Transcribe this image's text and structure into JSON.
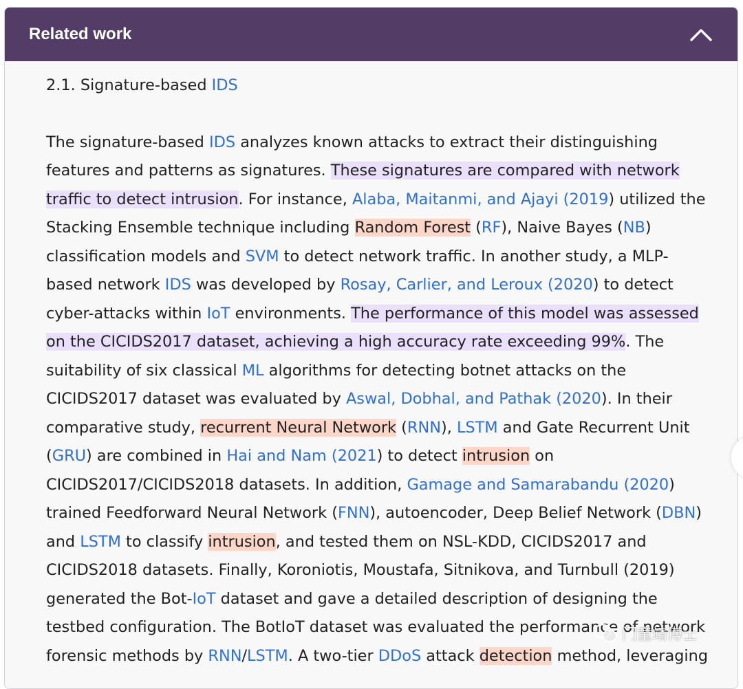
{
  "panel": {
    "title": "Related work",
    "collapse_icon": "chevron-up-icon",
    "accent_color": "#533d66"
  },
  "section": {
    "subheading_prefix": "2.1. Signature-based ",
    "subheading_link": "IDS"
  },
  "paragraph": [
    {
      "t": "The signature-based "
    },
    {
      "t": "IDS",
      "link": true
    },
    {
      "t": " analyzes known attacks to extract their distinguishing features and patterns as signatures. "
    },
    {
      "t": "These signatures are compared with network traffic to detect intrusion",
      "hl": "purple"
    },
    {
      "t": ". For instance, "
    },
    {
      "t": "Alaba, Maitanmi, and Ajayi (2019",
      "link": true
    },
    {
      "t": ") utilized the Stacking Ensemble technique including "
    },
    {
      "t": "Random Forest",
      "hl": "orange"
    },
    {
      "t": " ("
    },
    {
      "t": "RF",
      "link": true
    },
    {
      "t": "), Naive Bayes ("
    },
    {
      "t": "NB",
      "link": true
    },
    {
      "t": ") classification models and "
    },
    {
      "t": "SVM",
      "link": true
    },
    {
      "t": " to detect network traffic. In another study, a MLP-based network "
    },
    {
      "t": "IDS",
      "link": true
    },
    {
      "t": " was developed by "
    },
    {
      "t": "Rosay, Carlier, and Leroux (2020",
      "link": true
    },
    {
      "t": ") to detect cyber-attacks within "
    },
    {
      "t": "IoT",
      "link": true
    },
    {
      "t": " environments. "
    },
    {
      "t": "The performance of this model was assessed on the CICIDS2017 dataset, achieving a high accuracy rate exceeding 99%",
      "hl": "purple"
    },
    {
      "t": ". The suitability of six classical "
    },
    {
      "t": "ML",
      "link": true
    },
    {
      "t": " algorithms for detecting botnet attacks on the CICIDS2017 dataset was evaluated by "
    },
    {
      "t": "Aswal, Dobhal, and Pathak (2020",
      "link": true
    },
    {
      "t": "). In their comparative study, "
    },
    {
      "t": "recurrent Neural Network",
      "hl": "orange"
    },
    {
      "t": " ("
    },
    {
      "t": "RNN",
      "link": true
    },
    {
      "t": "), "
    },
    {
      "t": "LSTM",
      "link": true
    },
    {
      "t": " and Gate Recurrent Unit ("
    },
    {
      "t": "GRU",
      "link": true
    },
    {
      "t": ") are combined in "
    },
    {
      "t": "Hai and Nam (2021",
      "link": true
    },
    {
      "t": ") to detect "
    },
    {
      "t": "intrusion",
      "hl": "orange"
    },
    {
      "t": " on CICIDS2017/CICIDS2018 datasets. In addition, "
    },
    {
      "t": "Gamage and Samarabandu (2020",
      "link": true
    },
    {
      "t": ") trained Feedforward Neural Network ("
    },
    {
      "t": "FNN",
      "link": true
    },
    {
      "t": "), autoencoder, Deep Belief Network ("
    },
    {
      "t": "DBN",
      "link": true
    },
    {
      "t": ") and "
    },
    {
      "t": "LSTM",
      "link": true
    },
    {
      "t": " to classify "
    },
    {
      "t": "intrusion",
      "hl": "orange"
    },
    {
      "t": ", and tested them on NSL-KDD, CICIDS2017 and CICIDS2018 datasets. Finally, Koroniotis, Moustafa, Sitnikova, and Turnbull (2019) generated the Bot-"
    },
    {
      "t": "IoT",
      "link": true
    },
    {
      "t": " dataset and gave a detailed description of designing the testbed configuration. The BotIoT dataset was evaluated the performance of network forensic methods by "
    },
    {
      "t": "RNN",
      "link": true
    },
    {
      "t": "/"
    },
    {
      "t": "LSTM",
      "link": true
    },
    {
      "t": ". A two-tier "
    },
    {
      "t": "DDoS",
      "link": true
    },
    {
      "t": " attack "
    },
    {
      "t": "detection",
      "hl": "orange"
    },
    {
      "t": " method, leveraging"
    }
  ],
  "colors": {
    "link": "#2e6fd8",
    "highlight_purple": "#ebe0fb",
    "highlight_orange": "#fcd6c8"
  },
  "watermark": {
    "icon": "wechat-icon",
    "text": "门童靖博士"
  }
}
